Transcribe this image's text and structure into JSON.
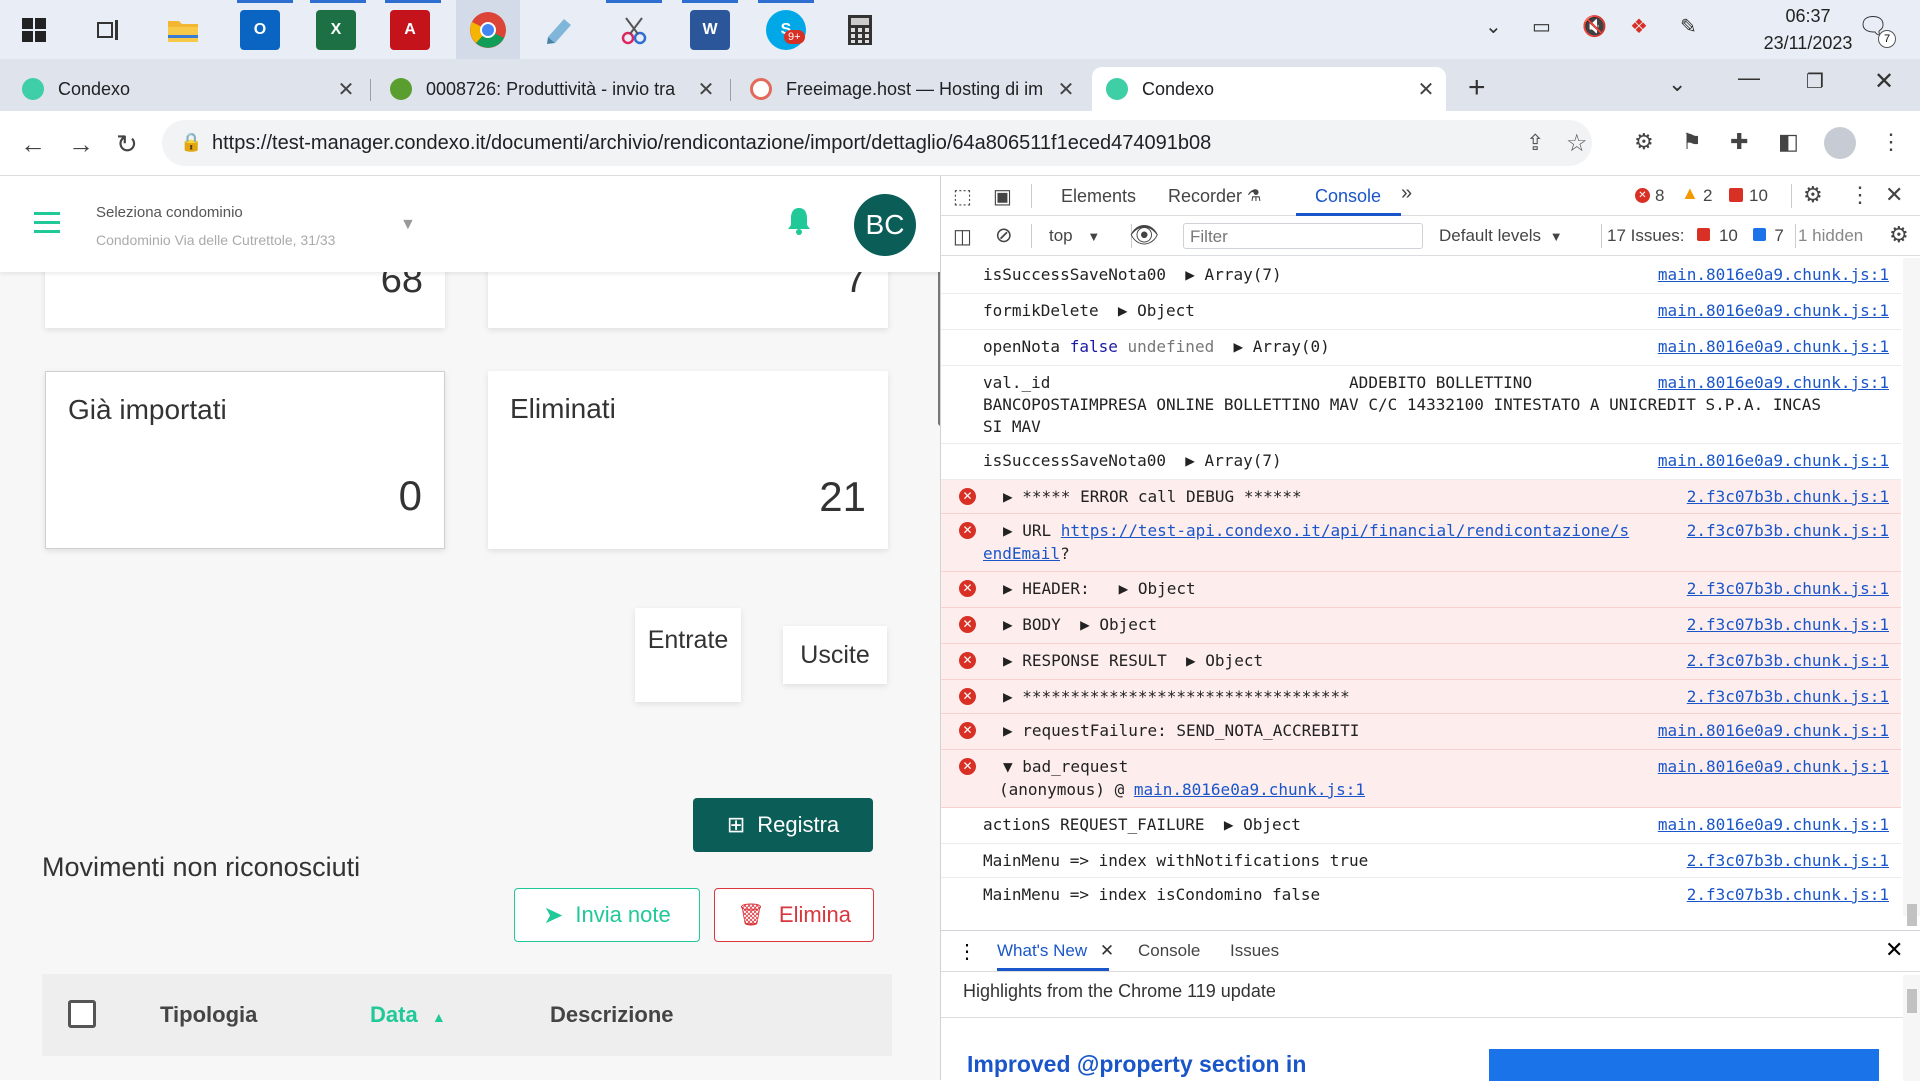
{
  "taskbar": {
    "icons": [
      "windows-start-icon",
      "task-view-icon",
      "file-explorer-icon",
      "outlook-icon",
      "excel-icon",
      "acrobat-icon",
      "chrome-icon",
      "notepad-icon",
      "snipping-tool-icon",
      "word-icon",
      "skype-icon",
      "calculator-icon"
    ],
    "skype_badge": "9+",
    "clock_time": "06:37",
    "clock_date": "23/11/2023",
    "notification_count": "7"
  },
  "browser": {
    "tabs": [
      {
        "label": "Condexo",
        "active": false
      },
      {
        "label": "0008726: Produttività - invio tra",
        "active": false
      },
      {
        "label": "Freeimage.host — Hosting di im",
        "active": false
      },
      {
        "label": "Condexo",
        "active": true
      }
    ],
    "url": "https://test-manager.condexo.it/documenti/archivio/rendicontazione/import/dettaglio/64a806511f1eced474091b08"
  },
  "app": {
    "header": {
      "select_label": "Seleziona condominio",
      "select_value": "Condominio Via delle Cutrettole, 31/33",
      "avatar_initials": "BC"
    },
    "cards": [
      {
        "title": "",
        "value": "68"
      },
      {
        "title": "",
        "value": "7"
      },
      {
        "title": "Già importati",
        "value": "0"
      },
      {
        "title": "Eliminati",
        "value": "21"
      }
    ],
    "toggle": {
      "entrate": "Entrate",
      "uscite": "Uscite"
    },
    "registra_label": "Registra",
    "section_title": "Movimenti non riconosciuti",
    "invia_note_label": "Invia note",
    "elimina_label": "Elimina",
    "table": {
      "columns": [
        "Tipologia",
        "Data",
        "Descrizione"
      ]
    },
    "colors": {
      "primary": "#0b5e58",
      "accent": "#20c997",
      "danger": "#d9363e"
    }
  },
  "devtools": {
    "tabs": [
      "Elements",
      "Recorder",
      "Console"
    ],
    "selected_tab": "Console",
    "error_count": "8",
    "warning_count": "2",
    "issue_count": "10",
    "context": "top",
    "filter_placeholder": "Filter",
    "levels": "Default levels",
    "issues_label": "17 Issues:",
    "issues_err": "10",
    "issues_info": "7",
    "hidden_label": "1 hidden",
    "drawer": {
      "tabs": [
        "What's New",
        "Console",
        "Issues"
      ],
      "highlights": "Highlights from the Chrome 119 update",
      "article_title": "Improved @property section in"
    },
    "log": [
      {
        "type": "log",
        "msg": "isSuccessSaveNota00  ▶ Array(7)",
        "src": "main.8016e0a9.chunk.js:1"
      },
      {
        "type": "log",
        "msg": "formikDelete  ▶ Object",
        "src": "main.8016e0a9.chunk.js:1"
      },
      {
        "type": "log",
        "msg": "openNota",
        "src": "main.8016e0a9.chunk.js:1"
      },
      {
        "type": "log",
        "msg": "val._id                               ADDEBITO BOLLETTINO",
        "msg2": "BANCOPOSTAIMPRESA ONLINE BOLLETTINO MAV C/C 14332100 INTESTATO A UNICREDIT S.P.A. INCAS",
        "msg3": "SI MAV",
        "src": "main.8016e0a9.chunk.js:1"
      },
      {
        "type": "log",
        "msg": "isSuccessSaveNota00  ▶ Array(7)",
        "src": "main.8016e0a9.chunk.js:1"
      },
      {
        "type": "error",
        "msg": "▶ ***** ERROR call DEBUG ******",
        "src": "2.f3c07b3b.chunk.js:1"
      },
      {
        "type": "error",
        "msg": "▶ URL ",
        "link": "https://test-api.condexo.it/api/financial/rendicontazione/s",
        "link2": "endEmail",
        "src": "2.f3c07b3b.chunk.js:1"
      },
      {
        "type": "error",
        "msg": "▶ HEADER:   ▶ Object",
        "src": "2.f3c07b3b.chunk.js:1"
      },
      {
        "type": "error",
        "msg": "▶ BODY  ▶ Object",
        "src": "2.f3c07b3b.chunk.js:1"
      },
      {
        "type": "error",
        "msg": "▶ RESPONSE RESULT  ▶ Object",
        "src": "2.f3c07b3b.chunk.js:1"
      },
      {
        "type": "error",
        "msg": "▶ **********************************",
        "src": "2.f3c07b3b.chunk.js:1"
      },
      {
        "type": "error",
        "msg": "▶ requestFailure: SEND_NOTA_ACCREBITI",
        "src": "main.8016e0a9.chunk.js:1"
      },
      {
        "type": "error",
        "msg": "▼ bad_request",
        "msg2": "(anonymous) @ ",
        "link": "main.8016e0a9.chunk.js:1",
        "src": "main.8016e0a9.chunk.js:1"
      },
      {
        "type": "log",
        "msg": "actionS REQUEST_FAILURE  ▶ Object",
        "src": "main.8016e0a9.chunk.js:1"
      },
      {
        "type": "log",
        "msg": "MainMenu => index withNotifications true",
        "src": "2.f3c07b3b.chunk.js:1"
      },
      {
        "type": "log",
        "msg": "MainMenu => index isCondomino false",
        "src": "2.f3c07b3b.chunk.js:1"
      }
    ],
    "opennota_parts": {
      "a": "openNota ",
      "b": "false",
      "c": " undefined",
      "d": "  ▶ Array(0)"
    }
  }
}
